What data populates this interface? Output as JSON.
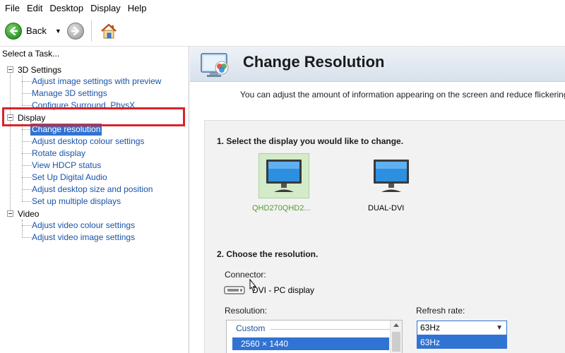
{
  "menu": [
    "File",
    "Edit",
    "Desktop",
    "Display",
    "Help"
  ],
  "toolbar": {
    "back_label": "Back"
  },
  "left_panel": {
    "header": "Select a Task...",
    "categories": [
      {
        "label": "3D Settings",
        "tasks": [
          "Adjust image settings with preview",
          "Manage 3D settings",
          "Configure Surround, PhysX"
        ]
      },
      {
        "label": "Display",
        "tasks": [
          "Change resolution",
          "Adjust desktop colour settings",
          "Rotate display",
          "View HDCP status",
          "Set Up Digital Audio",
          "Adjust desktop size and position",
          "Set up multiple displays"
        ]
      },
      {
        "label": "Video",
        "tasks": [
          "Adjust video colour settings",
          "Adjust video image settings"
        ]
      }
    ],
    "selected_task": "Change resolution"
  },
  "main": {
    "title": "Change Resolution",
    "description": "You can adjust the amount of information appearing on the screen and reduce flickering. You",
    "step1_title": "1. Select the display you would like to change.",
    "displays": [
      {
        "name": "QHD270QHD2...",
        "selected": true
      },
      {
        "name": "DUAL-DVI",
        "selected": false
      }
    ],
    "step2_title": "2. Choose the resolution.",
    "connector_label": "Connector:",
    "connector_value": "DVI - PC display",
    "resolution_label": "Resolution:",
    "resolution_group": "Custom",
    "resolution_selected": "2560 × 1440",
    "refresh_label": "Refresh rate:",
    "refresh_value": "63Hz",
    "refresh_option": "63Hz"
  },
  "colors": {
    "accent": "#3173d2",
    "link": "#1a53a8",
    "highlight_box": "#d8232a",
    "selected_display_bg": "#d4ebc9"
  }
}
